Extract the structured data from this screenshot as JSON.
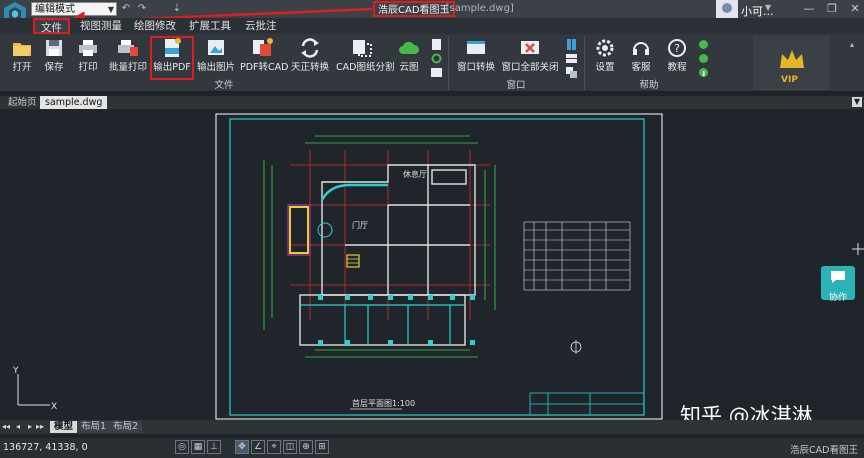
{
  "titlebar": {
    "mode_select": "编辑模式",
    "quick_access": [
      "↶",
      "↷",
      "⇣"
    ],
    "app_title": "浩辰CAD看图王",
    "file_title": "-[sample.dwg]",
    "user_name": "小可...",
    "window_buttons": [
      "—",
      "❐",
      "✕"
    ]
  },
  "menu": {
    "tabs": [
      "文件",
      "视图测量",
      "绘图修改",
      "扩展工具",
      "云批注"
    ]
  },
  "ribbon": {
    "file_group": {
      "label": "文件",
      "tools": [
        {
          "label": "打开",
          "icon": "open-folder-icon"
        },
        {
          "label": "保存",
          "icon": "save-disk-icon"
        },
        {
          "label": "打印",
          "icon": "print-icon"
        },
        {
          "label": "批量打印",
          "icon": "batch-print-icon"
        },
        {
          "label": "输出PDF",
          "icon": "export-pdf-icon"
        },
        {
          "label": "输出图片",
          "icon": "export-image-icon"
        },
        {
          "label": "PDF转CAD",
          "icon": "pdf-to-cad-icon"
        },
        {
          "label": "天正转换",
          "icon": "tangent-convert-icon"
        },
        {
          "label": "CAD图纸分割",
          "icon": "split-drawing-icon"
        },
        {
          "label": "云图",
          "icon": "cloud-icon"
        }
      ]
    },
    "window_group": {
      "label": "窗口",
      "tools": [
        {
          "label": "窗口转换",
          "icon": "window-switch-icon"
        },
        {
          "label": "窗口全部关闭",
          "icon": "close-all-windows-icon"
        }
      ]
    },
    "help_group": {
      "label": "帮助",
      "tools": [
        {
          "label": "设置",
          "icon": "settings-gear-icon"
        },
        {
          "label": "客服",
          "icon": "headset-icon"
        },
        {
          "label": "教程",
          "icon": "help-question-icon"
        }
      ]
    },
    "vip": "VIP"
  },
  "doc_tabs": {
    "tabs": [
      "起始页",
      "sample.dwg"
    ],
    "active": 1
  },
  "drawing": {
    "plan_title": "首层平面图1:100",
    "room_top": "休息厅",
    "room_mid": "门厅",
    "axis_y": "Y",
    "axis_x": "X"
  },
  "layout_tabs": {
    "nav": [
      "◂◂",
      "◂",
      "▸",
      "▸▸"
    ],
    "tabs": [
      "模型",
      "布局1",
      "布局2"
    ]
  },
  "statusbar": {
    "coords": "136727, 41338, 0",
    "buttons": [
      "◎",
      "▦",
      "⊥",
      "✥",
      "∠",
      "⌖",
      "◫",
      "⊕",
      "⊞"
    ],
    "app": "浩辰CAD看图王"
  },
  "collab": {
    "label": "协作"
  },
  "watermark": "知乎 @冰淇淋",
  "colors": {
    "highlight_box": "#d91f1f",
    "drawing_frame": "#2ad1d1",
    "wall": "#e0e0e0",
    "grid": "#d82c2c",
    "dimension": "#3bd24a",
    "vip_gold": "#e6b528"
  }
}
